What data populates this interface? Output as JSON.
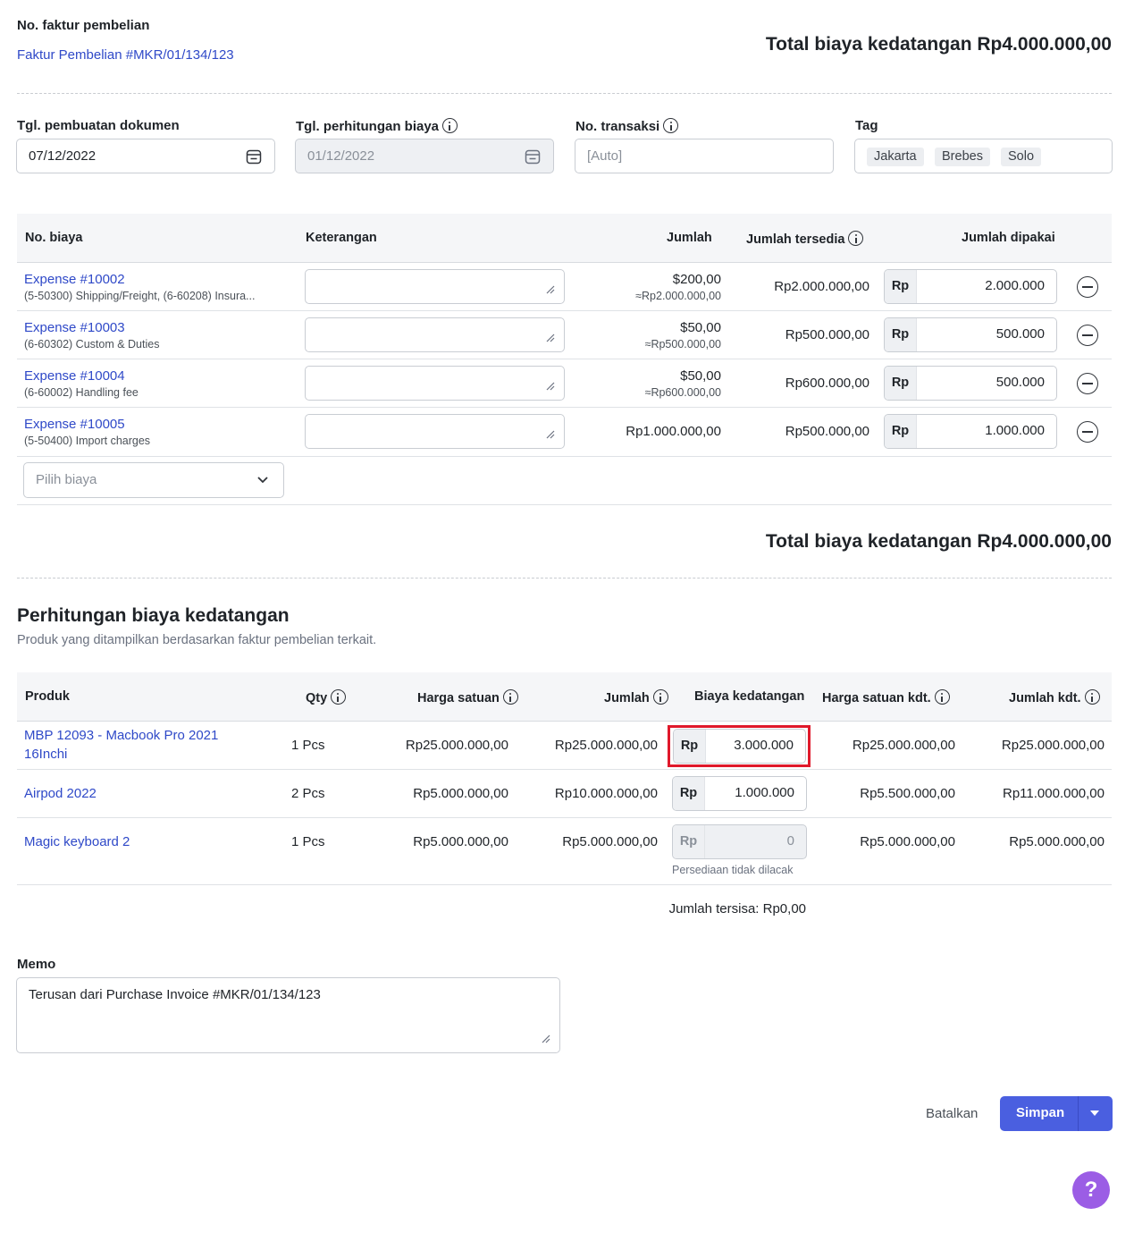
{
  "header": {
    "invoice_label": "No. faktur pembelian",
    "invoice_link": "Faktur Pembelian #MKR/01/134/123",
    "total_top": "Total biaya kedatangan Rp4.000.000,00"
  },
  "form": {
    "doc_date_label": "Tgl. pembuatan dokumen",
    "doc_date_value": "07/12/2022",
    "calc_date_label": "Tgl. perhitungan biaya",
    "calc_date_value": "01/12/2022",
    "trans_label": "No. transaksi",
    "trans_placeholder": "[Auto]",
    "tag_label": "Tag",
    "tags": [
      "Jakarta",
      "Brebes",
      "Solo"
    ]
  },
  "expenses": {
    "headers": {
      "no": "No. biaya",
      "desc": "Keterangan",
      "amount": "Jumlah",
      "available": "Jumlah tersedia",
      "used": "Jumlah dipakai"
    },
    "rows": [
      {
        "title": "Expense #10002",
        "sub": "(5-50300) Shipping/Freight, (6-60208) Insura...",
        "amount": "$200,00",
        "amount_sub": "≈Rp2.000.000,00",
        "available": "Rp2.000.000,00",
        "currency": "Rp",
        "used": "2.000.000"
      },
      {
        "title": "Expense #10003",
        "sub": "(6-60302) Custom & Duties",
        "amount": "$50,00",
        "amount_sub": "≈Rp500.000,00",
        "available": "Rp500.000,00",
        "currency": "Rp",
        "used": "500.000"
      },
      {
        "title": "Expense #10004",
        "sub": "(6-60002) Handling fee",
        "amount": "$50,00",
        "amount_sub": "≈Rp600.000,00",
        "available": "Rp600.000,00",
        "currency": "Rp",
        "used": "500.000"
      },
      {
        "title": "Expense #10005",
        "sub": "(5-50400) Import charges",
        "amount": "Rp1.000.000,00",
        "amount_sub": "",
        "available": "Rp500.000,00",
        "currency": "Rp",
        "used": "1.000.000"
      }
    ],
    "select_placeholder": "Pilih biaya",
    "total": "Total biaya kedatangan Rp4.000.000,00"
  },
  "calc": {
    "title": "Perhitungan biaya kedatangan",
    "subtitle": "Produk yang ditampilkan berdasarkan faktur pembelian terkait.",
    "headers": {
      "product": "Produk",
      "qty": "Qty",
      "unit_price": "Harga satuan",
      "amount": "Jumlah",
      "landed": "Biaya kedatangan",
      "unit_landed": "Harga satuan kdt.",
      "total_landed": "Jumlah kdt."
    },
    "rows": [
      {
        "product_line1": "MBP 12093 - Macbook Pro 2021",
        "product_line2": "16Inchi",
        "qty": "1 Pcs",
        "unit_price": "Rp25.000.000,00",
        "amount": "Rp25.000.000,00",
        "currency": "Rp",
        "landed": "3.000.000",
        "unit_landed": "Rp25.000.000,00",
        "total_landed": "Rp25.000.000,00",
        "note": ""
      },
      {
        "product_line1": "Airpod 2022",
        "product_line2": "",
        "qty": "2 Pcs",
        "unit_price": "Rp5.000.000,00",
        "amount": "Rp10.000.000,00",
        "currency": "Rp",
        "landed": "1.000.000",
        "unit_landed": "Rp5.500.000,00",
        "total_landed": "Rp11.000.000,00",
        "note": ""
      },
      {
        "product_line1": "Magic keyboard 2",
        "product_line2": "",
        "qty": "1 Pcs",
        "unit_price": "Rp5.000.000,00",
        "amount": "Rp5.000.000,00",
        "currency": "Rp",
        "landed": "0",
        "unit_landed": "Rp5.000.000,00",
        "total_landed": "Rp5.000.000,00",
        "note": "Persediaan tidak dilacak"
      }
    ],
    "remaining": "Jumlah tersisa: Rp0,00"
  },
  "memo": {
    "label": "Memo",
    "value": "Terusan dari Purchase Invoice #MKR/01/134/123"
  },
  "actions": {
    "cancel": "Batalkan",
    "save": "Simpan"
  },
  "help_label": "?",
  "colors": {
    "link": "#2f49c8",
    "primary": "#4a5fe0",
    "highlight": "#e0192b",
    "help": "#9b5de5"
  }
}
